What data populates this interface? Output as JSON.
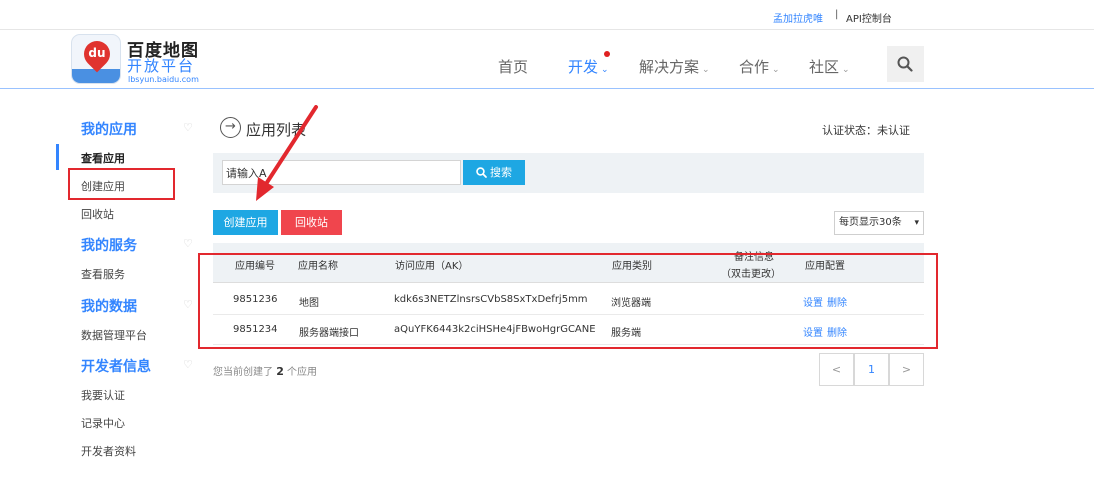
{
  "topbar": {
    "user": "孟加拉虎唯",
    "separator": "|",
    "console": "API控制台"
  },
  "brand": {
    "logo_text": "du",
    "name": "百度地图",
    "sub": "开放平台",
    "url": "lbsyun.baidu.com"
  },
  "nav": [
    {
      "label": "首页",
      "has_caret": false
    },
    {
      "label": "开发",
      "has_caret": true
    },
    {
      "label": "解决方案",
      "has_caret": true
    },
    {
      "label": "合作",
      "has_caret": true
    },
    {
      "label": "社区",
      "has_caret": true
    }
  ],
  "nav_caret": "⌄",
  "sidebar": {
    "sections": [
      {
        "title": "我的应用",
        "items": [
          "查看应用",
          "创建应用",
          "回收站"
        ]
      },
      {
        "title": "我的服务",
        "items": [
          "查看服务"
        ]
      },
      {
        "title": "我的数据",
        "items": [
          "数据管理平台"
        ]
      },
      {
        "title": "开发者信息",
        "items": [
          "我要认证",
          "记录中心",
          "开发者资料"
        ]
      }
    ],
    "chevron": "♡"
  },
  "main": {
    "title_icon": "→",
    "title": "应用列表",
    "cert_status": "认证状态：未认证",
    "search": {
      "value": "请输入A",
      "placeholder": "",
      "button": "搜索"
    },
    "buttons": {
      "create": "创建应用",
      "recycle": "回收站"
    },
    "per_page": "每页显示30条",
    "per_page_arrow": "▾",
    "table": {
      "headers": [
        "应用编号",
        "应用名称",
        "访问应用（AK）",
        "应用类别",
        "备注信息",
        "（双击更改）",
        "应用配置"
      ],
      "rows": [
        {
          "id": "9851236",
          "name": "地图",
          "ak": "kdk6s3NETZlnsrsCVbS8SxTxDefrj5mm",
          "type": "浏览器端",
          "note": "",
          "actions": [
            "设置",
            "删除"
          ]
        },
        {
          "id": "9851234",
          "name": "服务器端接口",
          "ak": "aQuYFK6443k2ciHSHe4jFBwoHgrGCANE",
          "type": "服务端",
          "note": "",
          "actions": [
            "设置",
            "删除"
          ]
        }
      ]
    },
    "summary": {
      "prefix": "您当前创建了 ",
      "count": "2",
      "suffix": " 个应用"
    },
    "pagination": {
      "prev": "<",
      "current": "1",
      "next": ">"
    }
  },
  "colors": {
    "accent": "#3385ff",
    "button_blue": "#1ea7e3",
    "button_red": "#f0454d",
    "annotation_red": "#e2282e"
  }
}
